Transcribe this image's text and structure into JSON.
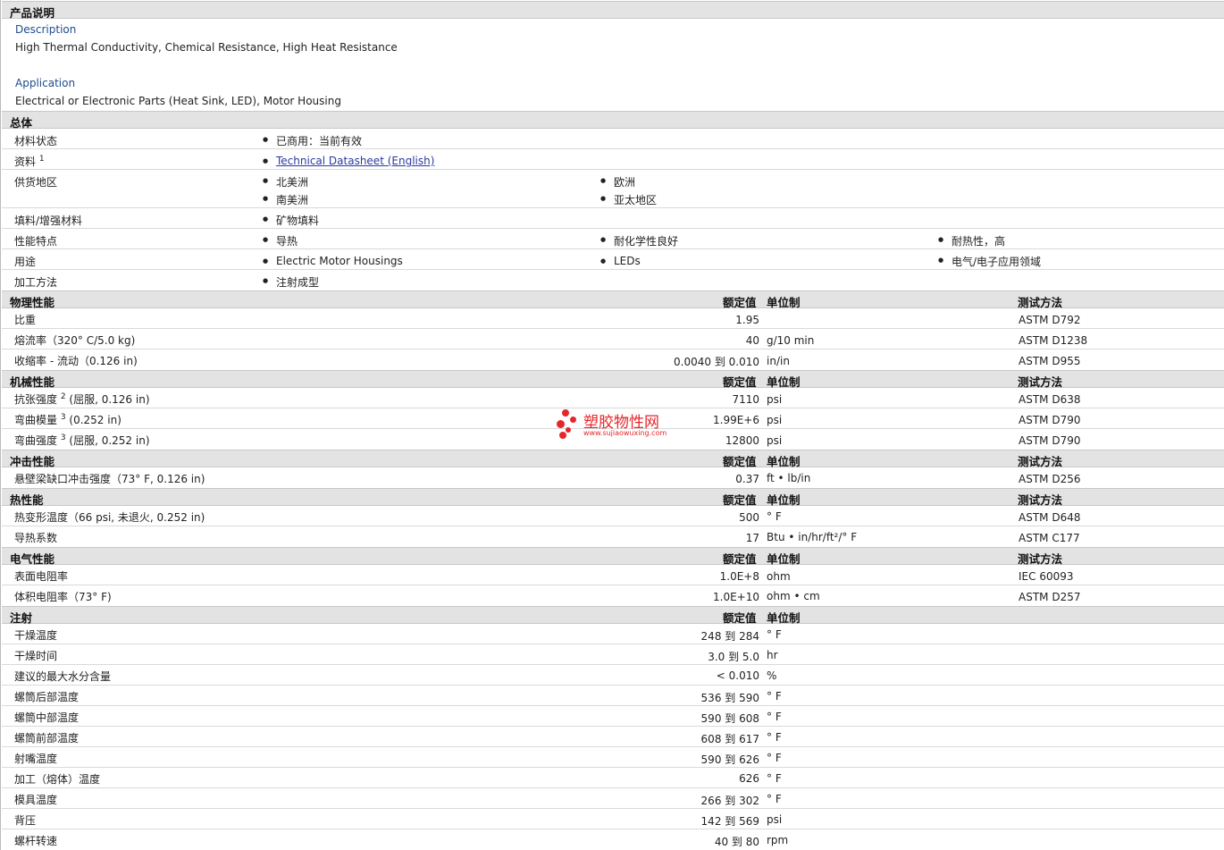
{
  "product_desc": {
    "header": "产品说明",
    "desc_label": "Description",
    "desc_text": "High Thermal Conductivity, Chemical Resistance, High Heat Resistance",
    "app_label": "Application",
    "app_text": "Electrical or Electronic Parts (Heat Sink, LED), Motor Housing"
  },
  "general": {
    "header": "总体",
    "rows": [
      {
        "label": "材料状态",
        "items": [
          "已商用：当前有效"
        ]
      },
      {
        "label": "资料",
        "sup": "1",
        "items": [
          "Technical Datasheet (English)"
        ]
      },
      {
        "label": "供货地区",
        "items": [
          "北美洲",
          "欧洲",
          "南美洲",
          "亚太地区"
        ]
      },
      {
        "label": "填料/增强材料",
        "items": [
          "矿物填料"
        ]
      },
      {
        "label": "性能特点",
        "items": [
          "导热",
          "耐化学性良好",
          "耐热性，高"
        ]
      },
      {
        "label": "用途",
        "items": [
          "Electric Motor Housings",
          "LEDs",
          "电气/电子应用领域"
        ]
      },
      {
        "label": "加工方法",
        "items": [
          "注射成型"
        ]
      }
    ]
  },
  "col_headers": {
    "value": "额定值",
    "unit": "单位制",
    "test": "测试方法"
  },
  "physical": {
    "header": "物理性能",
    "rows": [
      {
        "label": "比重",
        "value": "1.95",
        "unit": "",
        "test": "ASTM D792"
      },
      {
        "label": "熔流率（320° C/5.0 kg)",
        "value": "40",
        "unit": "g/10 min",
        "test": "ASTM D1238"
      },
      {
        "label": "收缩率 - 流动（0.126 in)",
        "value": "0.0040 到  0.010",
        "unit": "in/in",
        "test": "ASTM D955"
      }
    ]
  },
  "mechanical": {
    "header": "机械性能",
    "rows": [
      {
        "label": "抗张强度",
        "sup": "2",
        "suffix": "(屈服, 0.126 in)",
        "value": "7110",
        "unit": "psi",
        "test": "ASTM D638"
      },
      {
        "label": "弯曲模量",
        "sup": "3",
        "suffix": "(0.252 in)",
        "value": "1.99E+6",
        "unit": "psi",
        "test": "ASTM D790"
      },
      {
        "label": "弯曲强度",
        "sup": "3",
        "suffix": "(屈服, 0.252 in)",
        "value": "12800",
        "unit": "psi",
        "test": "ASTM D790"
      }
    ]
  },
  "impact": {
    "header": "冲击性能",
    "rows": [
      {
        "label": "悬壁梁缺口冲击强度（73° F, 0.126 in)",
        "value": "0.37",
        "unit": "ft • lb/in",
        "test": "ASTM D256"
      }
    ]
  },
  "thermal": {
    "header": "热性能",
    "rows": [
      {
        "label": "热变形温度（66 psi, 未退火, 0.252 in)",
        "value": "500",
        "unit": "° F",
        "test": "ASTM D648"
      },
      {
        "label": "导热系数",
        "value": "17",
        "unit": "Btu • in/hr/ft²/° F",
        "test": "ASTM C177"
      }
    ]
  },
  "electrical": {
    "header": "电气性能",
    "rows": [
      {
        "label": "表面电阻率",
        "value": "1.0E+8",
        "unit": "ohm",
        "test": "IEC 60093"
      },
      {
        "label": "体积电阻率（73° F)",
        "value": "1.0E+10",
        "unit": "ohm • cm",
        "test": "ASTM D257"
      }
    ]
  },
  "injection": {
    "header": "注射",
    "rows": [
      {
        "label": "干燥温度",
        "value": "248 到  284",
        "unit": "° F"
      },
      {
        "label": "干燥时间",
        "value": "3.0 到  5.0",
        "unit": "hr"
      },
      {
        "label": "建议的最大水分含量",
        "value": "< 0.010",
        "unit": "%"
      },
      {
        "label": "螺筒后部温度",
        "value": "536 到  590",
        "unit": "° F"
      },
      {
        "label": "螺筒中部温度",
        "value": "590 到  608",
        "unit": "° F"
      },
      {
        "label": "螺筒前部温度",
        "value": "608 到  617",
        "unit": "° F"
      },
      {
        "label": "射嘴温度",
        "value": "590 到  626",
        "unit": "° F"
      },
      {
        "label": "加工（熔体）温度",
        "value": "626",
        "unit": "° F"
      },
      {
        "label": "模具温度",
        "value": "266 到  302",
        "unit": "° F"
      },
      {
        "label": "背压",
        "value": "142 到  569",
        "unit": "psi"
      },
      {
        "label": "螺杆转速",
        "value": "40 到  80",
        "unit": "rpm"
      }
    ]
  },
  "watermark": {
    "title": "塑胶物性网",
    "url": "www.sujiaowuxing.com",
    "color": "#e5262a"
  }
}
